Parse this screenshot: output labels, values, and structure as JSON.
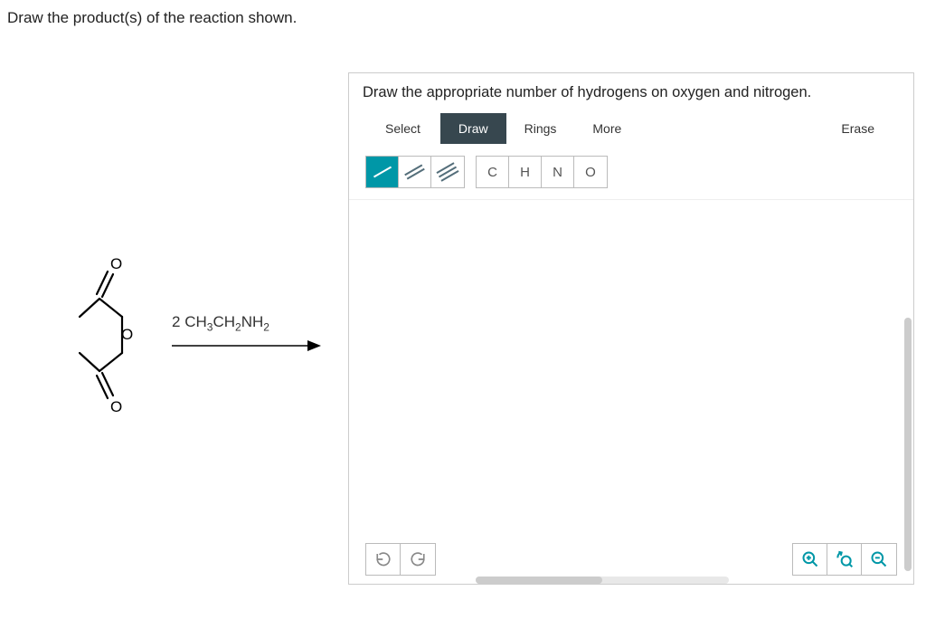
{
  "question": "Draw the product(s) of the reaction shown.",
  "reaction": {
    "reagent_prefix": "2",
    "reagent_formula": "CH3CH2NH2",
    "starting_material": "glutaric anhydride (cyclic anhydride with 5-membered ring, two C=O groups and one O in ring)"
  },
  "panel": {
    "instruction": "Draw the appropriate number of hydrogens on oxygen and nitrogen.",
    "toolbar": {
      "select": "Select",
      "draw": "Draw",
      "rings": "Rings",
      "more": "More",
      "erase": "Erase"
    },
    "bonds": {
      "single": "single-bond",
      "double": "double-bond",
      "triple": "triple-bond",
      "active": "single"
    },
    "elements": [
      "C",
      "H",
      "N",
      "O"
    ],
    "controls": {
      "undo": "undo",
      "redo": "redo",
      "zoom_in": "zoom-in",
      "zoom_reset": "zoom-reset",
      "zoom_out": "zoom-out"
    }
  }
}
